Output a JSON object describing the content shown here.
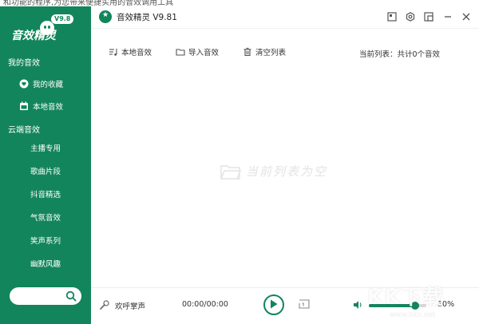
{
  "top_strip": {
    "text": "和功能的程序,为您带来便捷实用的音效调用工具"
  },
  "app": {
    "title": "音效精灵 V9.81",
    "logo_text": "音效精灵",
    "logo_version": "V9.8"
  },
  "sidebar": {
    "section_mine": "我的音效",
    "mine_items": [
      {
        "label": "我的收藏",
        "icon": "heart-chat-icon"
      },
      {
        "label": "本地音效",
        "icon": "calendar-icon"
      }
    ],
    "section_cloud": "云端音效",
    "cloud_items": [
      "主播专用",
      "歌曲片段",
      "抖音精选",
      "气氛音效",
      "笑声系列",
      "幽默风趣"
    ]
  },
  "toolbar": {
    "local": "本地音效",
    "import": "导入音效",
    "clear": "清空列表",
    "list_info": "当前列表：共计0个音效"
  },
  "empty_text": "当前列表为空",
  "player": {
    "song": "欢呼掌声",
    "time": "00:00/00:00",
    "volume_pct": "80%",
    "volume_level": 0.8
  },
  "watermark": {
    "main": "KK下载",
    "sub": "www.kkx.net"
  },
  "colors": {
    "accent": "#13855c"
  }
}
